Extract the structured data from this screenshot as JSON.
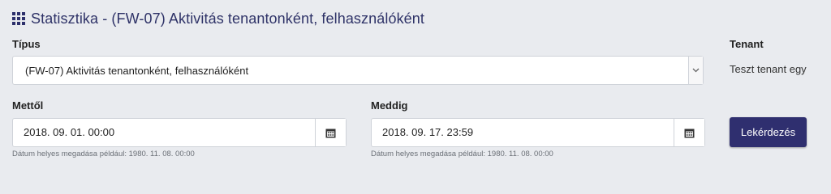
{
  "header": {
    "title": "Statisztika - (FW-07) Aktivitás tenantonként, felhasználóként"
  },
  "form": {
    "type_label": "Típus",
    "type_value": "(FW-07) Aktivitás tenantonként, felhasználóként",
    "tenant_label": "Tenant",
    "tenant_value": "Teszt tenant egy",
    "from_label": "Mettől",
    "from_value": "2018. 09. 01. 00:00",
    "from_hint": "Dátum helyes megadása például: 1980. 11. 08. 00:00",
    "to_label": "Meddig",
    "to_value": "2018. 09. 17. 23:59",
    "to_hint": "Dátum helyes megadása például: 1980. 11. 08. 00:00",
    "query_button": "Lekérdezés"
  },
  "colors": {
    "accent": "#2f2f6f",
    "background": "#e9ebef"
  },
  "icons": {
    "title": "grid-icon",
    "dropdown": "chevron-down-icon",
    "date_picker": "calendar-icon"
  }
}
